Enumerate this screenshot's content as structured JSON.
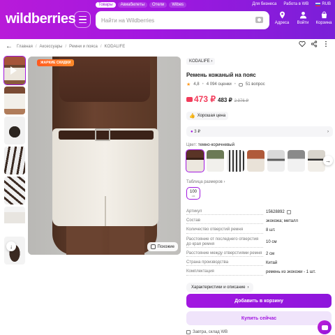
{
  "header": {
    "logo": "wildberries",
    "tabs": [
      "Товары",
      "Авиабилеты",
      "Отели",
      "Wibes"
    ],
    "right_links": [
      "Для бизнеса",
      "Работа в WB"
    ],
    "currency": "RUB",
    "search_placeholder": "Найти на Wildberries",
    "icons": [
      {
        "icon": "location-icon",
        "label": "Адреса"
      },
      {
        "icon": "user-icon",
        "label": "Войти"
      },
      {
        "icon": "cart-icon",
        "label": "Корзина"
      }
    ],
    "accent": "#a217e0"
  },
  "breadcrumbs": [
    "Главная",
    "Аксессуары",
    "Ремни и пояса",
    "KODALIFE"
  ],
  "gallery": {
    "badge": "ЖАРКИЕ СКИДКИ",
    "similar_label": "Похожие"
  },
  "product": {
    "brand": "KODALIFE",
    "title": "Ремень кожаный на пояс",
    "rating": "4,8",
    "reviews": "4 094 оценки",
    "questions": "51 вопрос",
    "price": "473 ₽",
    "price_wallet": "483 ₽",
    "price_old": "2 976 ₽",
    "price_color": "#f23b5a",
    "good_price": "Хорошая цена",
    "installment": "3 ₽",
    "color_label": "Цвет:",
    "color_value": "темно-коричневый",
    "size_table": "Таблица размеров",
    "size": "100",
    "size_sub": "см",
    "specs": [
      {
        "k": "Артикул",
        "v": "15628892"
      },
      {
        "k": "Состав",
        "v": "экокожа; металл"
      },
      {
        "k": "Количество отверстий ремня",
        "v": "8 шт."
      },
      {
        "k": "Расстояние от последнего отверстия до края ремня",
        "v": "10 см"
      },
      {
        "k": "Расстояние между отверстиями ремня",
        "v": "2 см"
      },
      {
        "k": "Страна производства",
        "v": "Китай"
      },
      {
        "k": "Комплектация",
        "v": "ремень из экокожи - 1 шт."
      }
    ],
    "chars_button": "Характеристики и описание",
    "add_to_cart": "Добавить в корзину",
    "buy_now": "Купить сейчас",
    "delivery": "Завтра, склад WB"
  }
}
